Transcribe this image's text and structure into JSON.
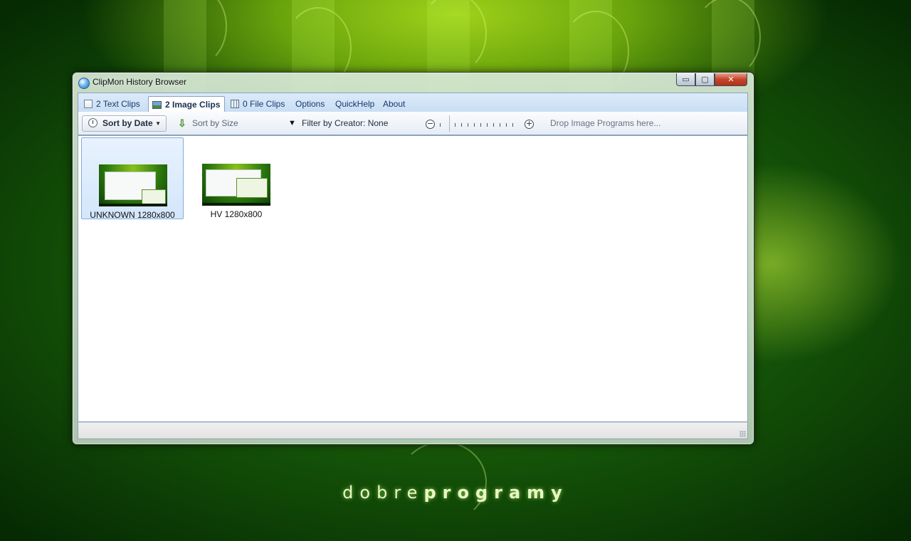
{
  "window": {
    "title": "ClipMon History Browser",
    "caption_buttons": {
      "minimize": "▭",
      "maximize": "▢",
      "close": "✕"
    }
  },
  "tabs": [
    {
      "label": "2 Text Clips",
      "icon": "text-clips-icon"
    },
    {
      "label": "2 Image Clips",
      "icon": "image-clips-icon",
      "active": true
    },
    {
      "label": "0 File Clips",
      "icon": "file-clips-icon"
    },
    {
      "label": "Options"
    },
    {
      "label": "QuickHelp"
    },
    {
      "label": "About"
    }
  ],
  "toolbar": {
    "sort_by_date": "Sort by Date",
    "sort_by_size": "Sort by Size",
    "filter": "Filter by Creator: None",
    "zoom_minus": "−",
    "zoom_plus": "+",
    "drop_hint": "Drop Image Programs here..."
  },
  "clips": [
    {
      "label": "UNKNOWN 1280x800",
      "selected": true
    },
    {
      "label": "HV 1280x800",
      "selected": false
    }
  ],
  "desktop": {
    "brand_light": "dobre",
    "brand_bold": "programy"
  },
  "colors": {
    "accent": "#1a3a6a",
    "selection": "#d4e6fb",
    "desktop_green": "#2f7d0d"
  }
}
